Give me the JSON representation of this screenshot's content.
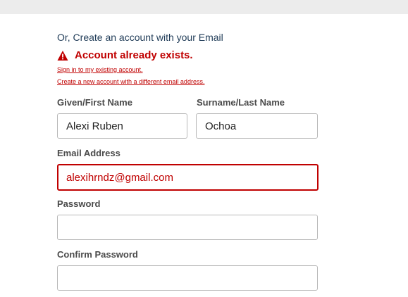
{
  "intro": "Or, Create an account with your Email",
  "alert": {
    "title": "Account already exists.",
    "signin_link": "Sign in to my existing account.",
    "create_link": "Create a new account with a different email address.",
    "color": "#c00000",
    "icon": "warning-triangle-icon"
  },
  "fields": {
    "first_name": {
      "label": "Given/First Name",
      "value": "Alexi Ruben"
    },
    "last_name": {
      "label": "Surname/Last Name",
      "value": "Ochoa"
    },
    "email": {
      "label": "Email Address",
      "value": "alexihrndz@gmail.com"
    },
    "password": {
      "label": "Password",
      "value": ""
    },
    "confirm_password": {
      "label": "Confirm Password",
      "value": ""
    }
  }
}
